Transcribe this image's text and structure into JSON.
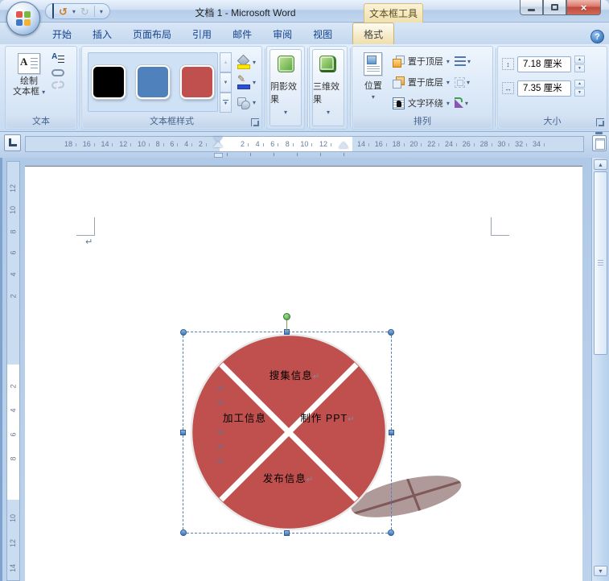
{
  "glyphs": {
    "dropdown": "▾",
    "spin_up": "▲",
    "spin_down": "▼",
    "scroll_up": "▲",
    "scroll_down": "▼",
    "gallery_up": "▲",
    "gallery_down": "▼",
    "gallery_more": "▼",
    "undo": "↺",
    "redo": "↻",
    "help": "?",
    "close": "×",
    "pencil": "✎",
    "height_icon": "↕",
    "width_icon": "↔",
    "paragraph": "↵"
  },
  "window": {
    "title": "文档 1 - Microsoft Word",
    "contextual_title": "文本框工具"
  },
  "tabs": {
    "items": [
      "开始",
      "插入",
      "页面布局",
      "引用",
      "邮件",
      "审阅",
      "视图",
      "格式"
    ]
  },
  "ribbon": {
    "text_group": {
      "caption": "文本",
      "draw_line1": "绘制",
      "draw_line2": "文本框"
    },
    "style_group": {
      "caption": "文本框样式",
      "swatches": [
        {
          "color": "#000000"
        },
        {
          "color": "#4f81bd"
        },
        {
          "color": "#c0504d"
        }
      ]
    },
    "effect_groups": [
      {
        "label": "阴影效果"
      },
      {
        "label": "三维效果"
      }
    ],
    "arrange_group": {
      "caption": "排列",
      "position_label": "位置",
      "items": [
        "置于顶层",
        "置于底层",
        "文字环绕"
      ]
    },
    "size_group": {
      "caption": "大小",
      "height_value": "7.18 厘米",
      "width_value": "7.35 厘米"
    }
  },
  "ruler": {
    "tab_selector": "L",
    "h_left": [
      "18",
      "16",
      "14",
      "12",
      "10",
      "8",
      "6",
      "4",
      "2"
    ],
    "h_mid": [
      "2",
      "4",
      "6",
      "8",
      "10",
      "12"
    ],
    "h_right": [
      "14",
      "16",
      "18",
      "20",
      "22",
      "24",
      "26",
      "28",
      "30",
      "32",
      "34"
    ],
    "v_top": [
      "12",
      "10",
      "8",
      "6",
      "4",
      "2"
    ],
    "v_mid": [
      "2",
      "4",
      "6",
      "8"
    ],
    "v_bottom": [
      "10",
      "12",
      "14"
    ]
  },
  "document": {
    "first_paragraph_mark": "↵",
    "diagram": {
      "fill_color": "#c0504d",
      "label_top": "搜集信息",
      "label_left": "加工信息",
      "label_right": "制作 PPT",
      "label_bottom": "发布信息",
      "left_marks": [
        "↵",
        "↵",
        "↵",
        "↵",
        "↵"
      ]
    }
  }
}
